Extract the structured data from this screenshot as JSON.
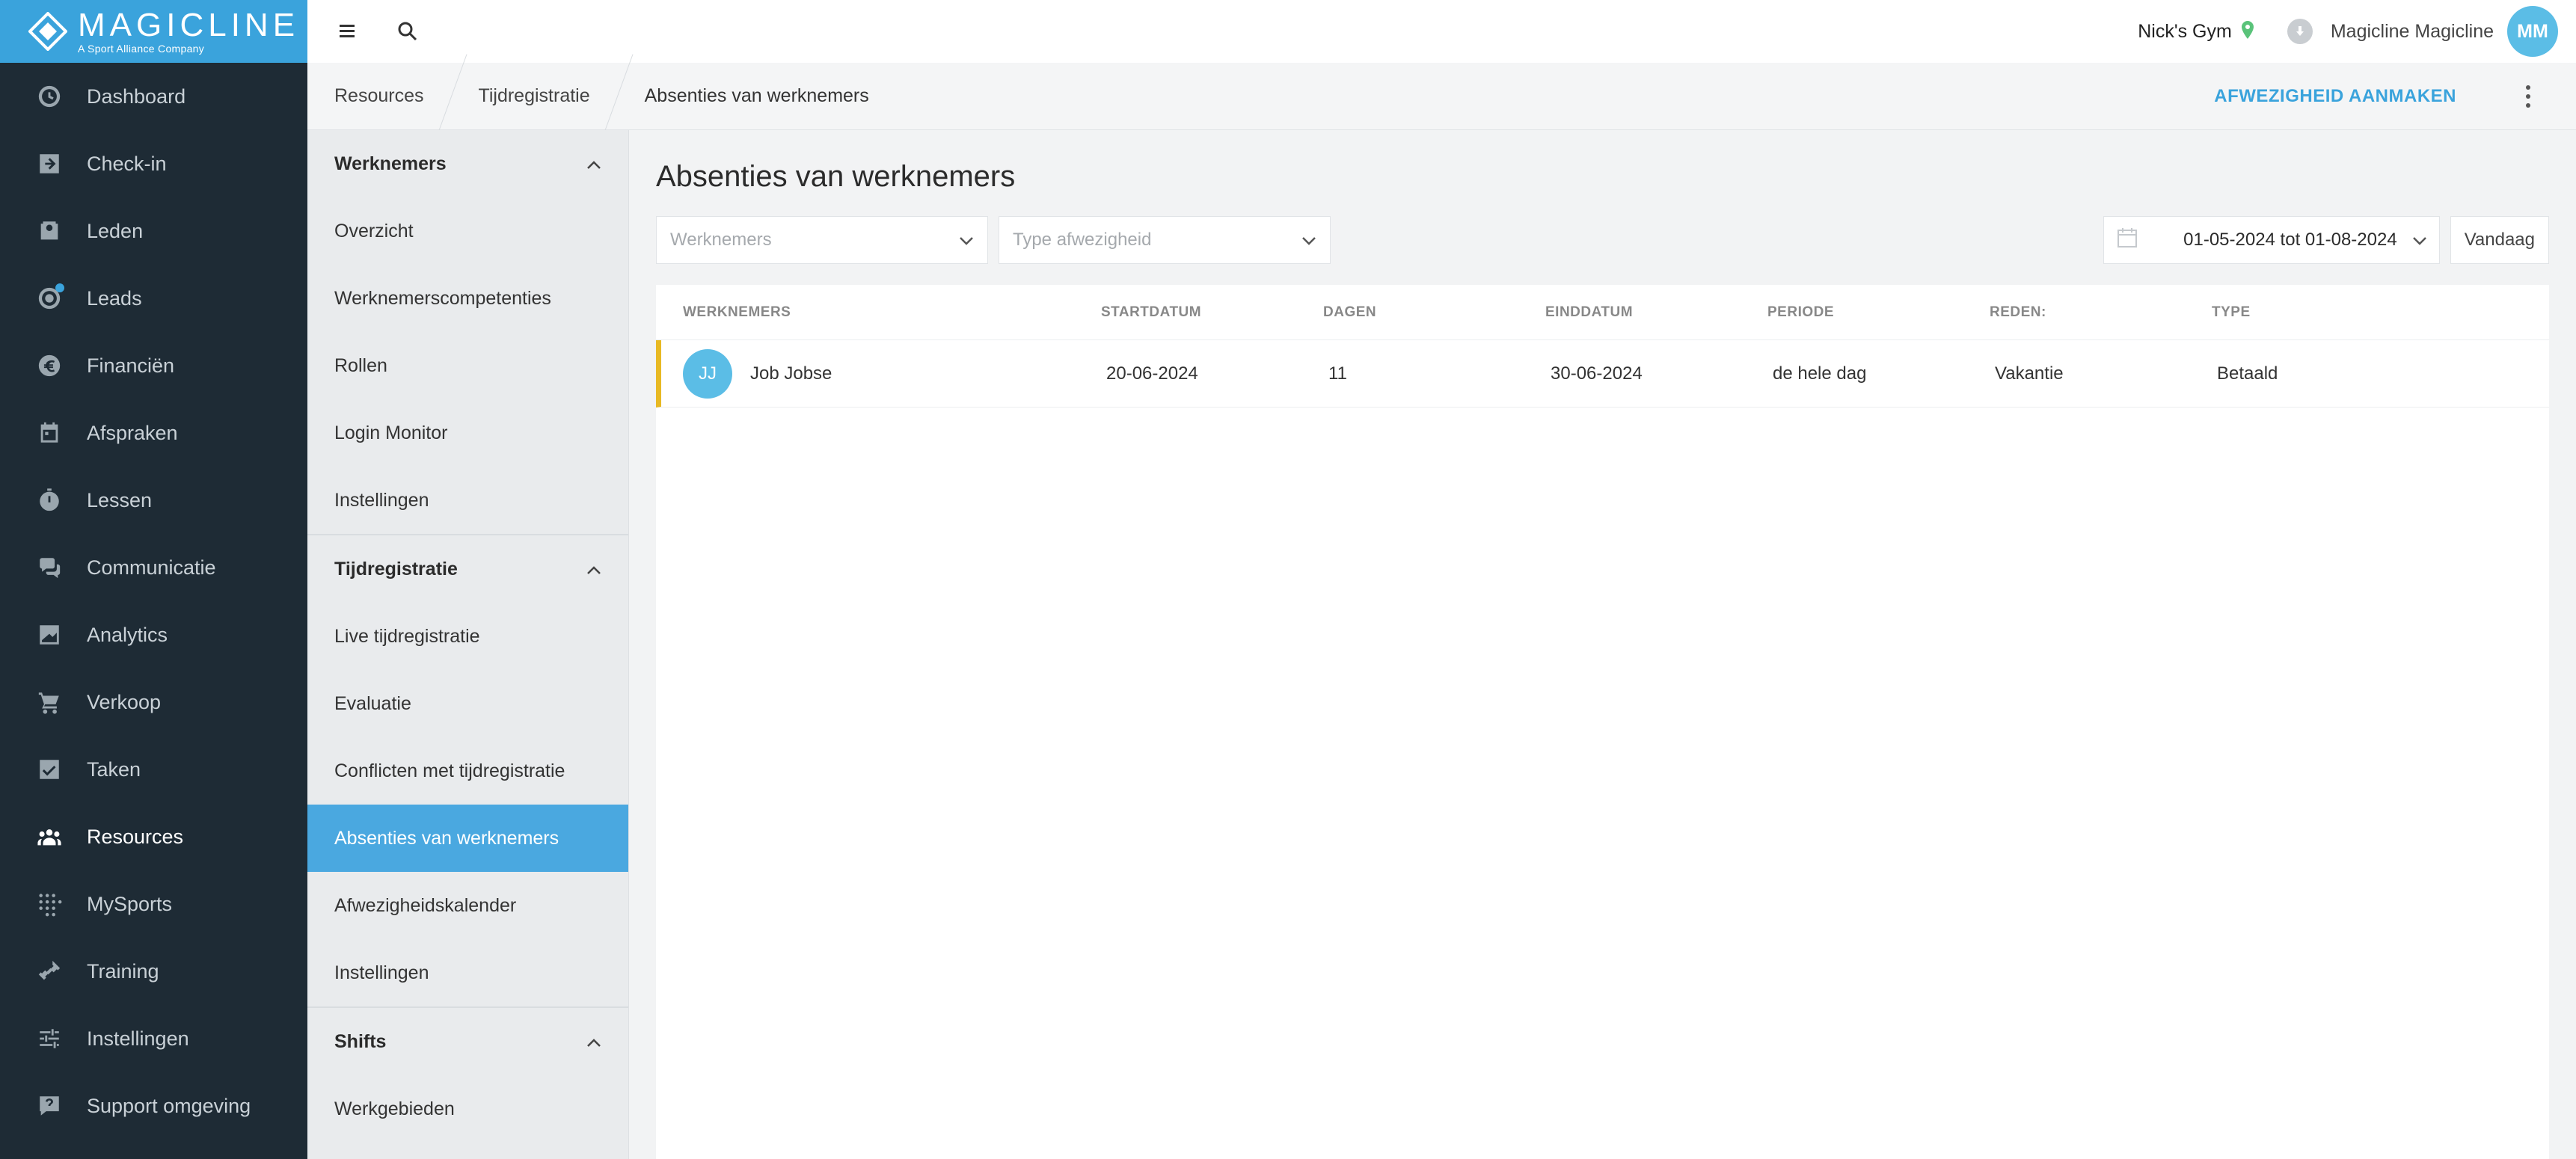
{
  "brand": {
    "name": "MAGICLINE",
    "tagline": "A Sport Alliance Company",
    "color": "#3aa3dc"
  },
  "nav": [
    {
      "label": "Dashboard",
      "icon": "dashboard-icon"
    },
    {
      "label": "Check-in",
      "icon": "checkin-icon"
    },
    {
      "label": "Leden",
      "icon": "members-icon"
    },
    {
      "label": "Leads",
      "icon": "leads-icon"
    },
    {
      "label": "Financiën",
      "icon": "euro-icon"
    },
    {
      "label": "Afspraken",
      "icon": "calendar-icon"
    },
    {
      "label": "Lessen",
      "icon": "stopwatch-icon"
    },
    {
      "label": "Communicatie",
      "icon": "chat-icon"
    },
    {
      "label": "Analytics",
      "icon": "chart-icon"
    },
    {
      "label": "Verkoop",
      "icon": "cart-icon"
    },
    {
      "label": "Taken",
      "icon": "checkbox-icon"
    },
    {
      "label": "Resources",
      "icon": "people-icon",
      "active": true
    },
    {
      "label": "MySports",
      "icon": "grid-dots-icon"
    },
    {
      "label": "Training",
      "icon": "dumbbell-icon"
    },
    {
      "label": "Instellingen",
      "icon": "sliders-icon"
    },
    {
      "label": "Support omgeving",
      "icon": "help-icon"
    }
  ],
  "topbar": {
    "gym": "Nick's Gym",
    "user": "Magicline Magicline",
    "user_initials": "MM"
  },
  "breadcrumb": [
    "Resources",
    "Tijdregistratie",
    "Absenties van werknemers"
  ],
  "actions": {
    "create": "AFWEZIGHEID AANMAKEN"
  },
  "submenu": {
    "sections": [
      {
        "title": "Werknemers",
        "items": [
          "Overzicht",
          "Werknemerscompetenties",
          "Rollen",
          "Login Monitor",
          "Instellingen"
        ]
      },
      {
        "title": "Tijdregistratie",
        "items": [
          "Live tijdregistratie",
          "Evaluatie",
          "Conflicten met tijdregistratie",
          "Absenties van werknemers",
          "Afwezigheidskalender",
          "Instellingen"
        ]
      },
      {
        "title": "Shifts",
        "items": [
          "Werkgebieden"
        ]
      }
    ],
    "active": "Absenties van werknemers"
  },
  "page": {
    "title": "Absenties van werknemers",
    "filters": {
      "employees_placeholder": "Werknemers",
      "type_placeholder": "Type afwezigheid",
      "date_range": "01-05-2024 tot 01-08-2024",
      "today": "Vandaag"
    },
    "table": {
      "columns": [
        "WERKNEMERS",
        "STARTDATUM",
        "DAGEN",
        "EINDDATUM",
        "PERIODE",
        "REDEN:",
        "TYPE"
      ],
      "rows": [
        {
          "initials": "JJ",
          "name": "Job Jobse",
          "start": "20-06-2024",
          "days": "11",
          "end": "30-06-2024",
          "period": "de hele dag",
          "reason": "Vakantie",
          "type": "Betaald",
          "status_color": "#e8b923"
        }
      ]
    }
  }
}
